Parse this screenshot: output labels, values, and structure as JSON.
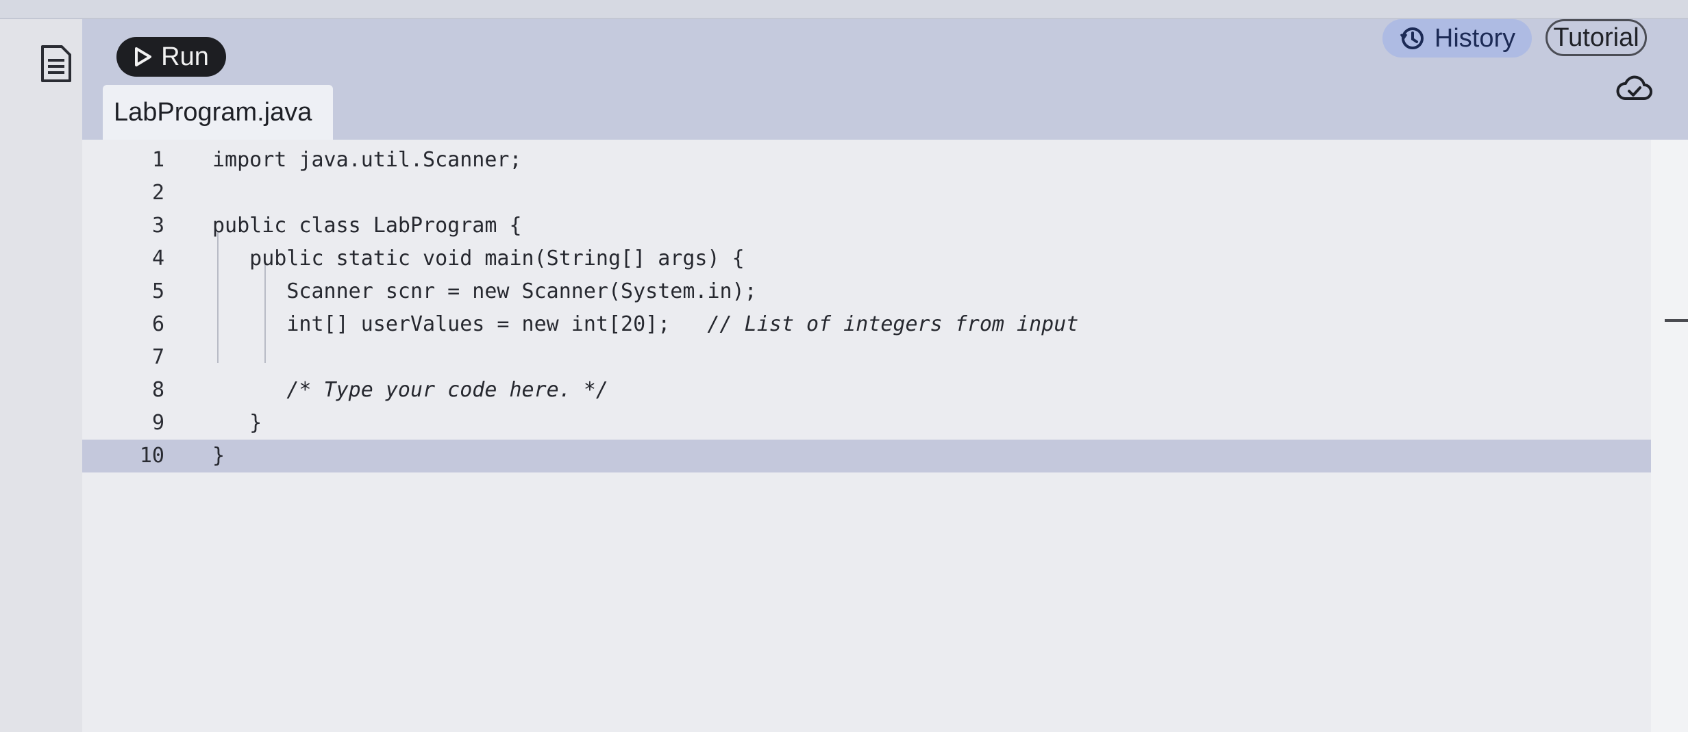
{
  "toolbar": {
    "run_label": "Run",
    "history_label": "History",
    "tutorial_label": "Tutorial"
  },
  "icons": {
    "file": "file-document-icon",
    "run": "play-icon",
    "history": "history-clock-icon",
    "cloud": "cloud-check-icon"
  },
  "colors": {
    "run_button": "#1d1e22",
    "history_button": "#aebbe3",
    "toolbar": "#c5cadd",
    "active_line": "#c4c8dc"
  },
  "editor": {
    "filename": "LabProgram.java",
    "active_line": 10,
    "lines": [
      {
        "n": "1",
        "code": "import java.util.Scanner;",
        "comment": ""
      },
      {
        "n": "2",
        "code": "",
        "comment": ""
      },
      {
        "n": "3",
        "code": "public class LabProgram {",
        "comment": ""
      },
      {
        "n": "4",
        "code": "   public static void main(String[] args) {",
        "comment": ""
      },
      {
        "n": "5",
        "code": "      Scanner scnr = new Scanner(System.in);",
        "comment": ""
      },
      {
        "n": "6",
        "code": "      int[] userValues = new int[20];   ",
        "comment": "// List of integers from input"
      },
      {
        "n": "7",
        "code": "",
        "comment": ""
      },
      {
        "n": "8",
        "code": "      ",
        "comment": "/* Type your code here. */"
      },
      {
        "n": "9",
        "code": "   }",
        "comment": ""
      },
      {
        "n": "10",
        "code": "}",
        "comment": ""
      }
    ]
  }
}
